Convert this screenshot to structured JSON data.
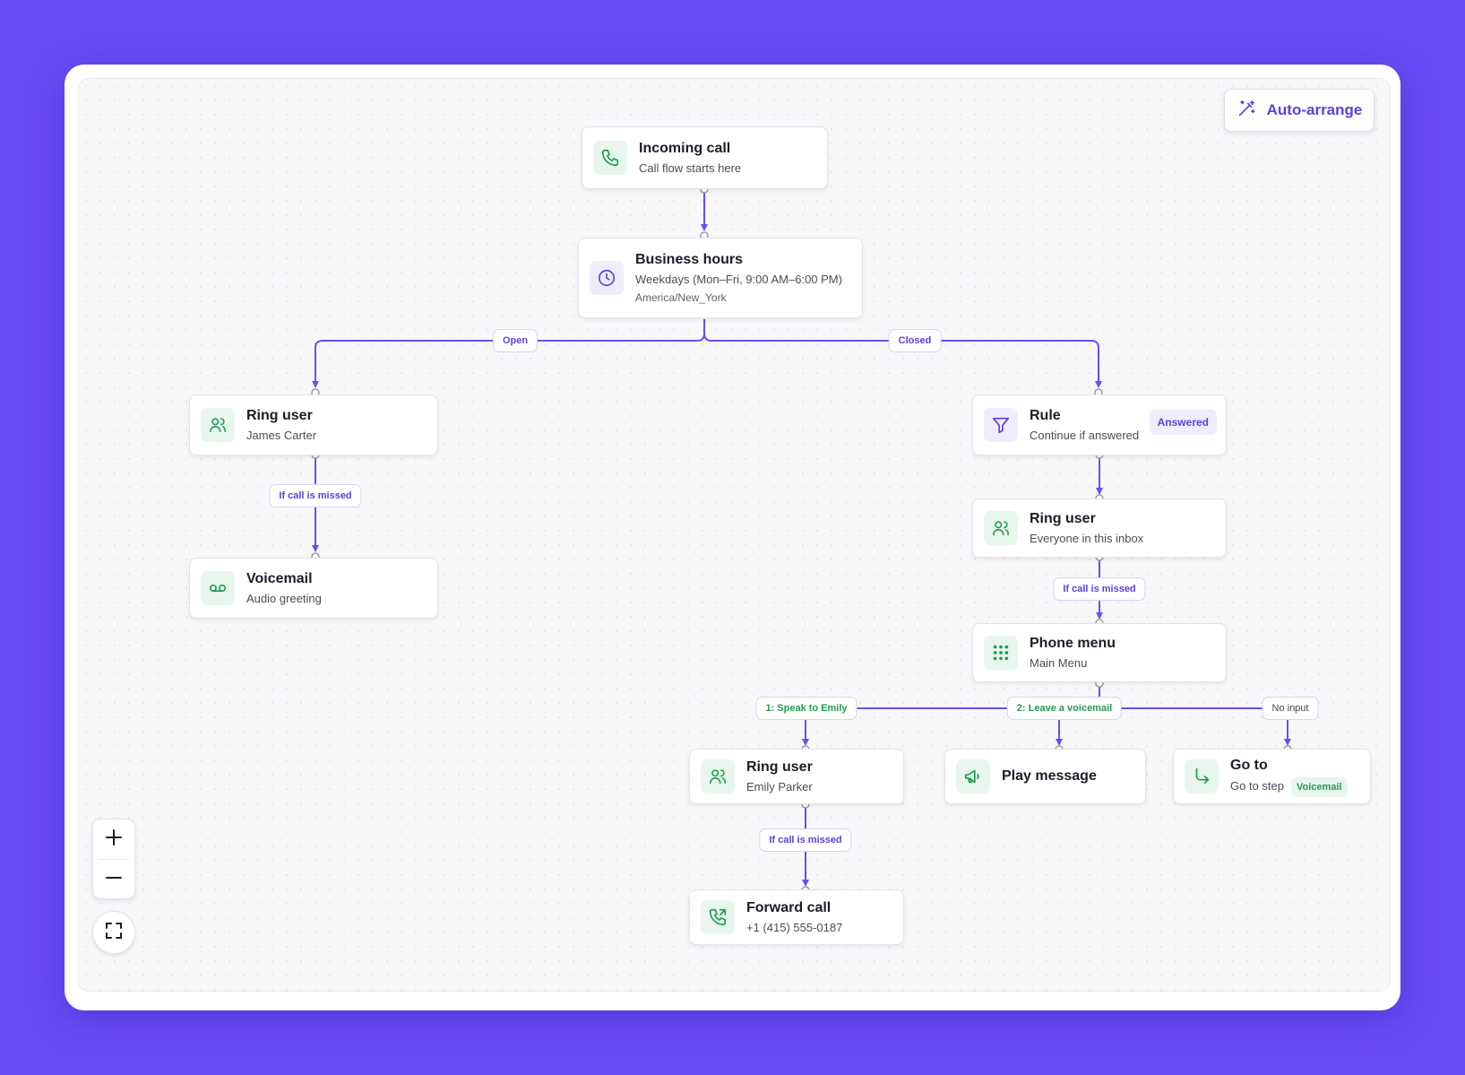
{
  "toolbar": {
    "auto_arrange_label": "Auto-arrange",
    "auto_arrange_icon": "magic-wand-icon"
  },
  "zoom": {
    "zoom_in_icon": "plus-icon",
    "zoom_out_icon": "minus-icon",
    "fit_icon": "fit-screen-icon"
  },
  "colors": {
    "background": "#6a4cf7",
    "accent": "#5b3fe0",
    "green": "#1f9d4f",
    "edge": "#6a4cf7"
  },
  "nodes": {
    "incoming_call": {
      "title": "Incoming call",
      "subtitle": "Call flow starts here",
      "icon": "phone-icon"
    },
    "business_hours": {
      "title": "Business hours",
      "subtitle": "Weekdays (Mon–Fri, 9:00 AM–6:00 PM)",
      "detail": "America/New_York",
      "icon": "clock-icon"
    },
    "ring_user_james": {
      "title": "Ring user",
      "subtitle": "James Carter",
      "icon": "users-icon"
    },
    "voicemail": {
      "title": "Voicemail",
      "subtitle": "Audio greeting",
      "icon": "voicemail-icon"
    },
    "rule": {
      "title": "Rule",
      "subtitle": "Continue if answered",
      "badge": "Answered",
      "icon": "filter-icon"
    },
    "ring_user_inbox": {
      "title": "Ring user",
      "subtitle": "Everyone in this inbox",
      "icon": "users-icon"
    },
    "phone_menu": {
      "title": "Phone menu",
      "subtitle": "Main Menu",
      "icon": "dialpad-icon"
    },
    "ring_user_emily": {
      "title": "Ring user",
      "subtitle": "Emily Parker",
      "icon": "users-icon"
    },
    "play_message": {
      "title": "Play message",
      "icon": "megaphone-icon"
    },
    "go_to": {
      "title": "Go to",
      "subtitle": "Go to step",
      "tag": "Voicemail",
      "icon": "redirect-arrow-icon"
    },
    "forward_call": {
      "title": "Forward call",
      "subtitle": "+1 (415) 555-0187",
      "icon": "phone-forward-icon"
    }
  },
  "edge_labels": {
    "open": "Open",
    "closed": "Closed",
    "missed_james": "If call is missed",
    "missed_inbox": "If call is missed",
    "option_1": "1: Speak to Emily",
    "option_2": "2: Leave a voicemail",
    "no_input": "No input",
    "missed_emily": "If call is missed"
  }
}
